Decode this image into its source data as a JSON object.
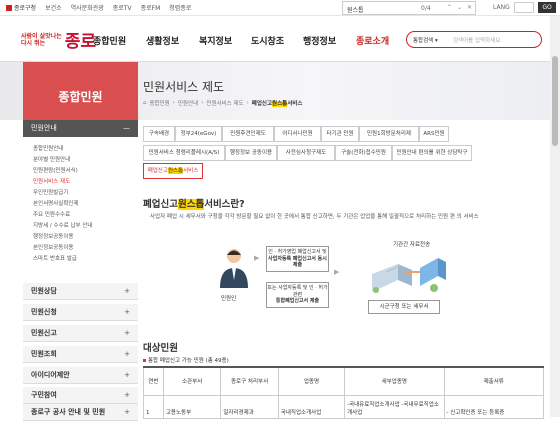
{
  "topbar": {
    "links": [
      "종로구청",
      "보건소",
      "역사문화관광",
      "종로TV",
      "종로FM",
      "청렴종로"
    ],
    "find_query": "원스톱",
    "find_count": "0/4",
    "lang_label": "LANG",
    "go_label": "GO"
  },
  "header": {
    "logo_small_1": "사람이 살맛나는",
    "logo_small_2": "다시 뛰는",
    "logo_big": "종로",
    "nav": [
      "종합민원",
      "생활정보",
      "복지정보",
      "도시창조",
      "행정정보",
      "종로소개"
    ],
    "search_select": "통합검색 ▾",
    "search_placeholder": "검색어를 입력하세요."
  },
  "side_title": "종합민원",
  "page_title": "민원서비스 제도",
  "breadcrumb": [
    "종합민원",
    "민원안내",
    "민원서비스 제도",
    "폐업신고",
    "원스톱",
    "서비스"
  ],
  "sidebar": {
    "head": "민원안내",
    "subs": [
      "종합민원안내",
      "분야별 민원안내",
      "민원편람(민원서식)",
      "민원서비스 제도",
      "무인민원발급기",
      "본인서명사실확인제",
      "주요 민원수수료",
      "지방세 / 수수료 납부 안내",
      "행정정보공동이용",
      "본인정보공동이용",
      "스마트 번호표 발급"
    ],
    "cats": [
      "민원상담",
      "민원신청",
      "민원신고",
      "민원조회",
      "아이디어제안",
      "구민참여",
      "종로구 공사 안내 및 민원"
    ]
  },
  "tabs": [
    "구속배경",
    "정부24(eGov)",
    "민원후견인제도",
    "어디서나민원",
    "타기관 민원",
    "민원1회방문처리제",
    "ARS민원",
    "민원서비스 청렴리플레시(A/S)",
    "행정정보 공동이용",
    "사전심사청구제도",
    "구술(전화)접수민원",
    "민원안내 편의를 위한 상담탁구",
    "폐업신고",
    "원스톱",
    "서비스"
  ],
  "content": {
    "h2_a": "폐업신고",
    "h2_b": "원스톱",
    "h2_c": "서비스란?",
    "desc": "사업자 폐업 시 세무서와 구청을 각각 방문할 필요 없이 한 곳에서 통합 신고하면, 두 기관은 업업을 통해 일괄적으로 처리하는 민원 편 의 서비스",
    "person_label": "민원인",
    "box1": [
      "인 · 허가영업 폐업신고서 및",
      "사업자등록 폐업신고서 동시 제출"
    ],
    "box2": [
      "또는 사업자등록 및 인 · 허가관련",
      "통합폐업신고서 제출"
    ],
    "transfer": "기관간 자료전송",
    "office": "시군구청 또는 세무서"
  },
  "section": {
    "h3": "대상민원",
    "sub": "통합 폐업신고 가능 민원 (총 49종)",
    "headers": [
      "연번",
      "소관부서",
      "종로구\n처리부서",
      "업종명",
      "세부업종명",
      "제출서류"
    ],
    "row1": [
      "1",
      "고용노동부",
      "일자리경제과",
      "국내직업소개사업",
      "-국내유료직업소개사업\n-국내무료직업소개사업",
      "- 신고확인증 또는 등록증"
    ]
  }
}
